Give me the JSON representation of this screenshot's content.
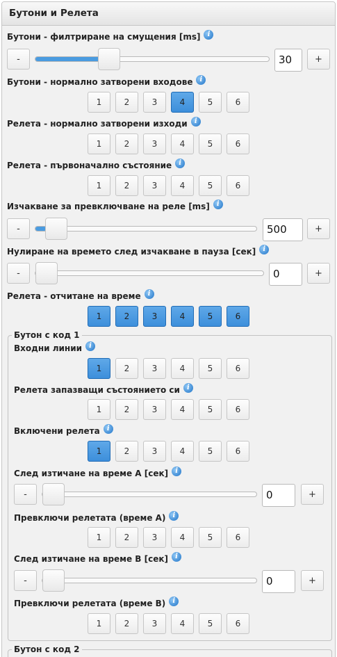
{
  "panel": {
    "title": "Бутони и Релета"
  },
  "info_glyph": "i",
  "numbers": [
    "1",
    "2",
    "3",
    "4",
    "5",
    "6"
  ],
  "minus": "-",
  "plus": "+",
  "settings": {
    "filter": {
      "label": "Бутони - филтриране на смущения [ms]",
      "value": "30",
      "slider_fraction": 0.33
    },
    "inputs_nc": {
      "label": "Бутони - нормално затворени входове",
      "active": [
        4
      ]
    },
    "relays_nc": {
      "label": "Релета - нормално затворени изходи",
      "active": []
    },
    "relays_init": {
      "label": "Релета - първоначално състояние",
      "active": []
    },
    "relay_wait": {
      "label": "Изчакване за превключване на реле [ms]",
      "value": "500",
      "slider_fraction": 0.05
    },
    "reset_wait": {
      "label": "Нулиране на времето след изчакване в пауза [сек]",
      "value": "0",
      "slider_fraction": 0
    },
    "time_count": {
      "label": "Релета - отчитане на време",
      "active": [
        1,
        2,
        3,
        4,
        5,
        6
      ]
    }
  },
  "group1": {
    "legend": "Бутон с код 1",
    "input_lines": {
      "label": "Входни линии",
      "active": [
        1
      ]
    },
    "keep_state": {
      "label": "Релета запазващи състоянието си",
      "active": []
    },
    "enabled": {
      "label": "Включени релета",
      "active": [
        1
      ]
    },
    "timeout_a": {
      "label": "След изтичане на време А [сек]",
      "value": "0",
      "slider_fraction": 0
    },
    "toggle_a": {
      "label": "Превключи релетата (време А)",
      "active": []
    },
    "timeout_b": {
      "label": "След изтичане на време В [сек]",
      "value": "0",
      "slider_fraction": 0
    },
    "toggle_b": {
      "label": "Превключи релетата (време В)",
      "active": []
    }
  },
  "group2": {
    "legend": "Бутон с код 2"
  },
  "colors": {
    "accent": "#4a9be0",
    "panel": "#f1f1f1"
  }
}
